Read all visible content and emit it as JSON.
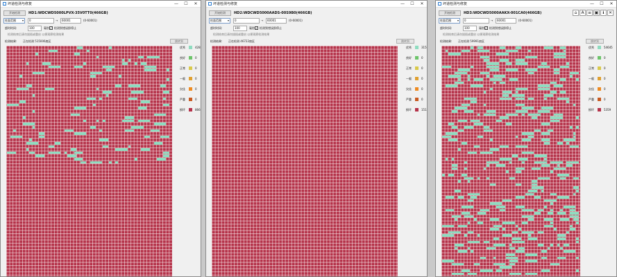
{
  "colors": {
    "excellent": "#8fdcc0",
    "good": "#6cc46a",
    "normal": "#d9c94a",
    "average": "#e0a030",
    "poor": "#ee8a20",
    "severe": "#c85a20",
    "damaged": "#b5334a"
  },
  "common": {
    "start_button": "开始检测",
    "range_type": "柱面范围",
    "range_start": "0",
    "arrow": "→",
    "range_end": "60001",
    "range_hint": "(0-60001)",
    "timeout_label": "超时时间:",
    "timeout_value": "100",
    "timeout_unit": "毫秒",
    "stop_on_bad": "检测到错误即停止",
    "hint": "检测结束后请勿拔插或重启 以便观察检测结果",
    "result_label": "检测结果:",
    "select_button": "跳转到",
    "legend_labels": [
      "优秀",
      "良好",
      "正常",
      "一般",
      "欠佳",
      "严重",
      "损坏"
    ]
  },
  "windows": [
    {
      "title": "坏道检测与修复",
      "disk": "HD1:WDCWD5000LPVX-35V0TT0(466GB)",
      "status": "正在检测 515006扇区",
      "legend_values": [
        "42854",
        "0",
        "0",
        "0",
        "0",
        "0",
        "8661"
      ]
    },
    {
      "title": "坏道检测与修复",
      "disk": "HD2:WDCWD5000AADS-00S9B0(466GB)",
      "status": "正在检测 46722扇区",
      "legend_values": [
        "31504",
        "0",
        "0",
        "0",
        "0",
        "0",
        "15138"
      ]
    },
    {
      "title": "坏道检测与修复",
      "disk": "HD3:WDCWD5000AAKX-001CA0(466GB)",
      "status": "正在检测 59991扇区",
      "legend_values": [
        "54645",
        "0",
        "0",
        "0",
        "0",
        "0",
        "5359"
      ]
    }
  ],
  "title_buttons": {
    "minimize": "—",
    "maximize": "☐",
    "close": "✕"
  },
  "toolbar_icons": [
    "⌂",
    "A",
    "≡",
    "▣",
    "ℹ",
    "✕"
  ]
}
